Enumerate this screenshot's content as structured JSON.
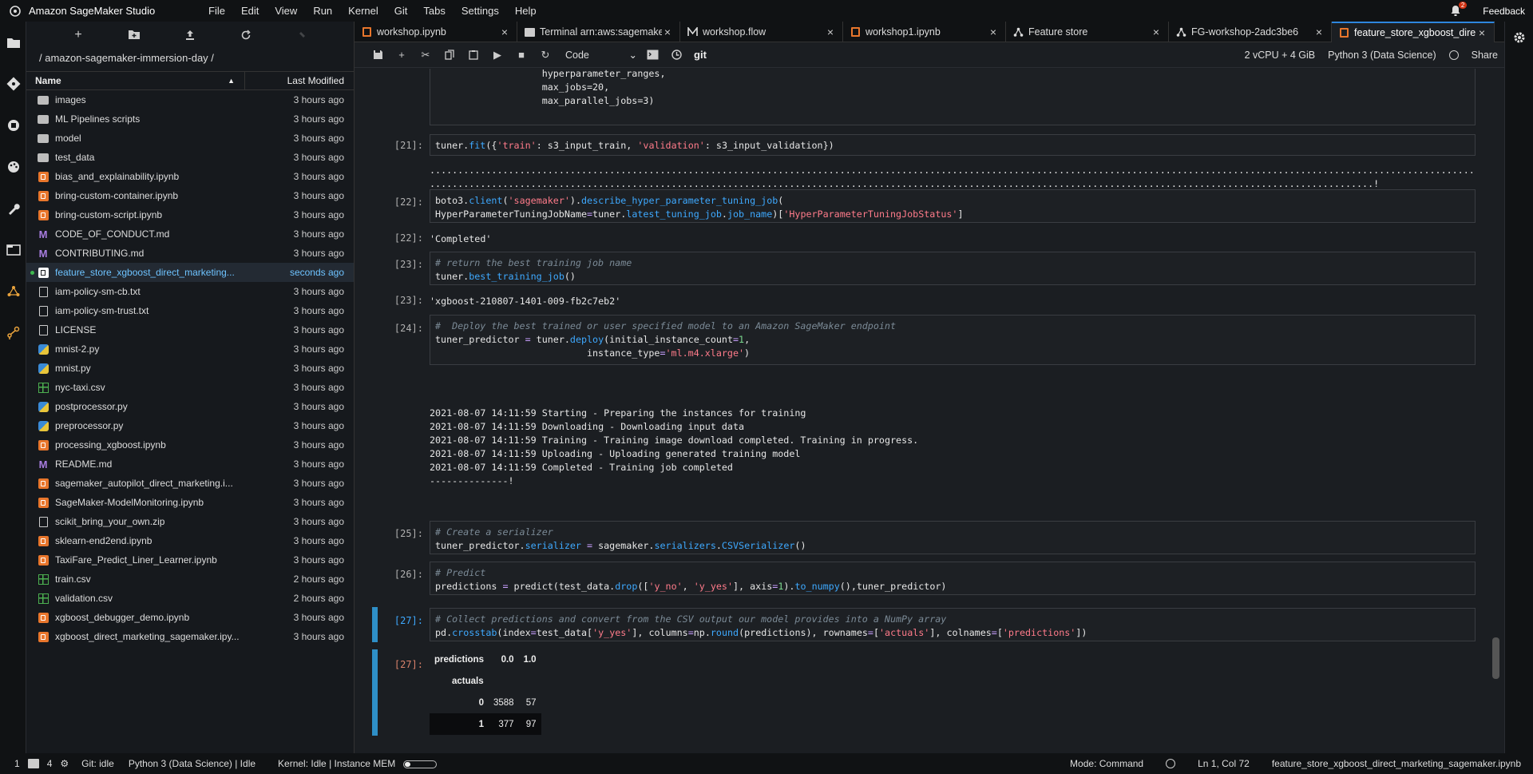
{
  "app": {
    "title": "Amazon SageMaker Studio",
    "feedback": "Feedback",
    "notification_count": "2"
  },
  "menu": [
    "File",
    "Edit",
    "View",
    "Run",
    "Kernel",
    "Git",
    "Tabs",
    "Settings",
    "Help"
  ],
  "filebrowser": {
    "breadcrumb": "/ amazon-sagemaker-immersion-day /",
    "col_name": "Name",
    "col_modified": "Last Modified",
    "files": [
      {
        "name": "images",
        "time": "3 hours ago",
        "type": "folder"
      },
      {
        "name": "ML Pipelines scripts",
        "time": "3 hours ago",
        "type": "folder"
      },
      {
        "name": "model",
        "time": "3 hours ago",
        "type": "folder"
      },
      {
        "name": "test_data",
        "time": "3 hours ago",
        "type": "folder"
      },
      {
        "name": "bias_and_explainability.ipynb",
        "time": "3 hours ago",
        "type": "nb"
      },
      {
        "name": "bring-custom-container.ipynb",
        "time": "3 hours ago",
        "type": "nb"
      },
      {
        "name": "bring-custom-script.ipynb",
        "time": "3 hours ago",
        "type": "nb"
      },
      {
        "name": "CODE_OF_CONDUCT.md",
        "time": "3 hours ago",
        "type": "md"
      },
      {
        "name": "CONTRIBUTING.md",
        "time": "3 hours ago",
        "type": "md"
      },
      {
        "name": "feature_store_xgboost_direct_marketing...",
        "time": "seconds ago",
        "type": "nbw",
        "selected": true
      },
      {
        "name": "iam-policy-sm-cb.txt",
        "time": "3 hours ago",
        "type": "txt"
      },
      {
        "name": "iam-policy-sm-trust.txt",
        "time": "3 hours ago",
        "type": "txt"
      },
      {
        "name": "LICENSE",
        "time": "3 hours ago",
        "type": "txt"
      },
      {
        "name": "mnist-2.py",
        "time": "3 hours ago",
        "type": "py"
      },
      {
        "name": "mnist.py",
        "time": "3 hours ago",
        "type": "py"
      },
      {
        "name": "nyc-taxi.csv",
        "time": "3 hours ago",
        "type": "csv"
      },
      {
        "name": "postprocessor.py",
        "time": "3 hours ago",
        "type": "py"
      },
      {
        "name": "preprocessor.py",
        "time": "3 hours ago",
        "type": "py"
      },
      {
        "name": "processing_xgboost.ipynb",
        "time": "3 hours ago",
        "type": "nb"
      },
      {
        "name": "README.md",
        "time": "3 hours ago",
        "type": "md"
      },
      {
        "name": "sagemaker_autopilot_direct_marketing.i...",
        "time": "3 hours ago",
        "type": "nb"
      },
      {
        "name": "SageMaker-ModelMonitoring.ipynb",
        "time": "3 hours ago",
        "type": "nb"
      },
      {
        "name": "scikit_bring_your_own.zip",
        "time": "3 hours ago",
        "type": "txt"
      },
      {
        "name": "sklearn-end2end.ipynb",
        "time": "3 hours ago",
        "type": "nb"
      },
      {
        "name": "TaxiFare_Predict_Liner_Learner.ipynb",
        "time": "3 hours ago",
        "type": "nb"
      },
      {
        "name": "train.csv",
        "time": "2 hours ago",
        "type": "csv"
      },
      {
        "name": "validation.csv",
        "time": "2 hours ago",
        "type": "csv"
      },
      {
        "name": "xgboost_debugger_demo.ipynb",
        "time": "3 hours ago",
        "type": "nb"
      },
      {
        "name": "xgboost_direct_marketing_sagemaker.ipy...",
        "time": "3 hours ago",
        "type": "nb"
      }
    ]
  },
  "tabs": [
    {
      "label": "workshop.ipynb",
      "icon": "nb"
    },
    {
      "label": "Terminal arn:aws:sagemake",
      "icon": "term"
    },
    {
      "label": "workshop.flow",
      "icon": "flow"
    },
    {
      "label": "workshop1.ipynb",
      "icon": "nb"
    },
    {
      "label": "Feature store",
      "icon": "fs"
    },
    {
      "label": "FG-workshop-2adc3be6",
      "icon": "fs"
    },
    {
      "label": "feature_store_xgboost_dire",
      "icon": "nb",
      "active": true
    }
  ],
  "toolbar": {
    "cell_type": "Code",
    "git": "git",
    "instance": "2 vCPU + 4 GiB",
    "kernel": "Python 3 (Data Science)",
    "share": "Share"
  },
  "cells": {
    "top_code": [
      "                   hyperparameter_ranges,",
      "                   max_jobs=20,",
      "                   max_parallel_jobs=3)"
    ],
    "p21": "[21]:",
    "p22": "[22]:",
    "p22o": "[22]:",
    "p23": "[23]:",
    "p23o": "[23]:",
    "p24": "[24]:",
    "p25": "[25]:",
    "p26": "[26]:",
    "p27": "[27]:",
    "p27o": "[27]:",
    "out22": "'Completed'",
    "out23": "'xgboost-210807-1401-009-fb2c7eb2'",
    "dots1": "...........................................................................................................................................................................................................................",
    "dots2": "........................................................................................................................................................................!",
    "out24": [
      "2021-08-07 14:11:59 Starting - Preparing the instances for training",
      "2021-08-07 14:11:59 Downloading - Downloading input data",
      "2021-08-07 14:11:59 Training - Training image download completed. Training in progress.",
      "2021-08-07 14:11:59 Uploading - Uploading generated training model",
      "2021-08-07 14:11:59 Completed - Training job completed",
      "--------------!"
    ]
  },
  "dataframe": {
    "col_header": "predictions",
    "cols": [
      "0.0",
      "1.0"
    ],
    "row_header": "actuals",
    "rows": [
      {
        "idx": "0",
        "v": [
          "3588",
          "57"
        ]
      },
      {
        "idx": "1",
        "v": [
          "377",
          "97"
        ]
      }
    ]
  },
  "status": {
    "left1": "1",
    "left2": "4",
    "git": "Git: idle",
    "kernel": "Python 3 (Data Science) | Idle",
    "kstatus": "Kernel: Idle | Instance MEM",
    "mode": "Mode: Command",
    "pos": "Ln 1, Col 72",
    "file": "feature_store_xgboost_direct_marketing_sagemaker.ipynb"
  },
  "colors": {
    "accent": "#2e86de",
    "active_cell": "#2e8fc7",
    "notebook_icon": "#e8762c"
  }
}
